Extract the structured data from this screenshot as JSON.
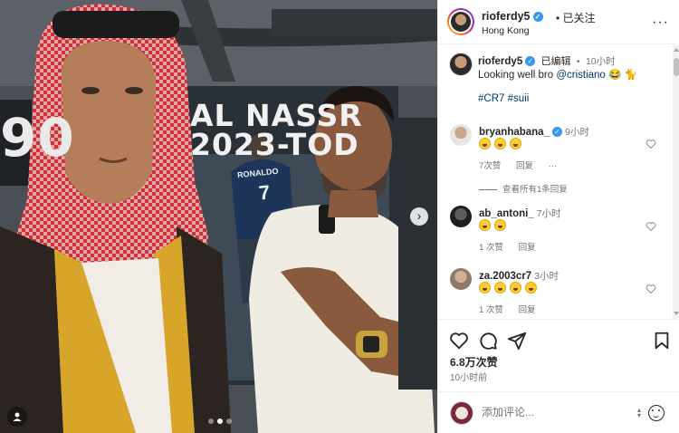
{
  "photo": {
    "banner_line1": "AL NASSR",
    "banner_line2": "2023-TOD",
    "banner_number": "90",
    "jersey_name": "RONALDO",
    "jersey_number": "7",
    "next_icon": "chevron-right-icon",
    "tag_icon": "person-tag-icon",
    "carousel_dots": 3,
    "active_dot": 1
  },
  "header": {
    "username": "rioferdy5",
    "follow_label": "已关注",
    "separator": "•",
    "location": "Hong Kong",
    "more_label": "···"
  },
  "caption": {
    "username": "rioferdy5",
    "edited": "已编辑",
    "separator": "•",
    "time": "10小时",
    "text_before": "Looking well bro ",
    "mention": "@cristiano",
    "text_after": " 😂 🐈",
    "hashtag1": "#CR7",
    "hashtag2": "#suii"
  },
  "comments": [
    {
      "username": "bryanhabana_",
      "verified": true,
      "time": "9小时",
      "emoji_count": 3,
      "likes": "7次赞",
      "reply": "回复",
      "more": "···",
      "view_replies": "查看所有1条回复"
    },
    {
      "username": "ab_antoni_",
      "verified": false,
      "time": "7小时",
      "emoji_count": 2,
      "likes": "1 次赞",
      "reply": "回复"
    },
    {
      "username": "za.2003cr7",
      "verified": false,
      "time": "3小时",
      "emoji_count": 4,
      "likes": "1 次赞",
      "reply": "回复"
    }
  ],
  "actions": {
    "like_icon": "heart-icon",
    "comment_icon": "comment-icon",
    "share_icon": "send-icon",
    "save_icon": "bookmark-icon",
    "likes": "6.8万次赞",
    "time_ago": "10小时前"
  },
  "add_comment": {
    "placeholder": "添加评论...",
    "emoji_icon": "smiley-icon"
  },
  "colors": {
    "verified": "#3897f0",
    "link": "#00376b",
    "secondary_text": "#737373",
    "border": "#efefef"
  }
}
